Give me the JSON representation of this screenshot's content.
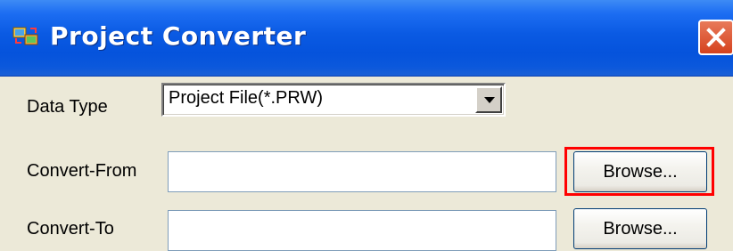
{
  "window": {
    "title": "Project Converter",
    "icon": "project-converter-app-icon",
    "close_icon": "close-icon"
  },
  "form": {
    "data_type": {
      "label": "Data Type",
      "selected": "Project File(*.PRW)"
    },
    "convert_from": {
      "label": "Convert-From",
      "value": "",
      "browse_label": "Browse..."
    },
    "convert_to": {
      "label": "Convert-To",
      "value": "",
      "browse_label": "Browse..."
    }
  },
  "colors": {
    "titlebar": "#0553dc",
    "close_button": "#d5421e",
    "highlight": "#ff0000",
    "dialog_bg": "#ece9d8"
  }
}
